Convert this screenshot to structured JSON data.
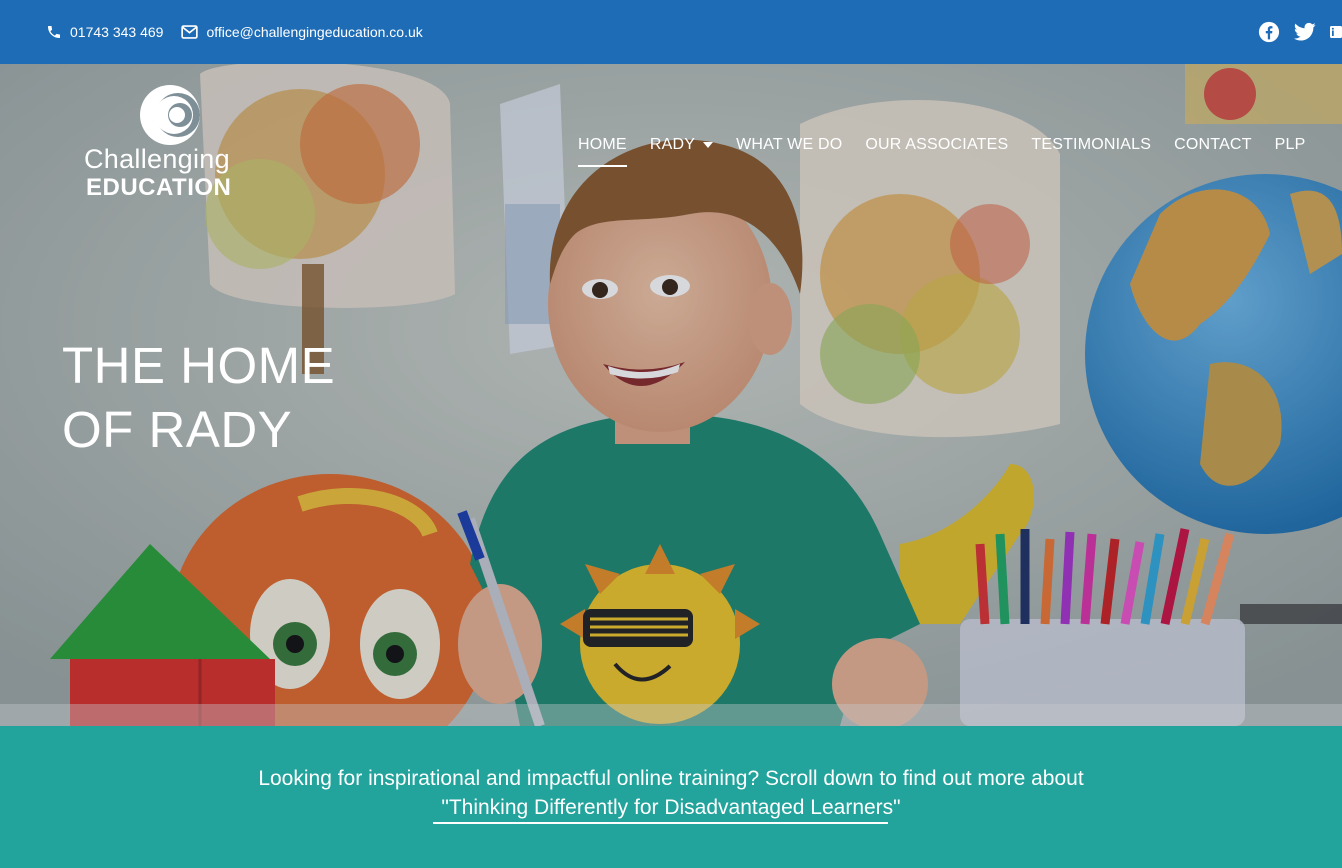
{
  "topbar": {
    "phone": "01743 343 469",
    "email": "office@challengingeducation.co.uk",
    "social": [
      "facebook-icon",
      "twitter-icon",
      "linkedin-icon"
    ],
    "background": "#1e6cb6"
  },
  "logo": {
    "line1": "Challenging",
    "line2": "EDUCATION"
  },
  "nav": {
    "items": [
      {
        "label": "HOME",
        "active": true
      },
      {
        "label": "RADY",
        "dropdown": true
      },
      {
        "label": "WHAT WE DO"
      },
      {
        "label": "OUR ASSOCIATES"
      },
      {
        "label": "TESTIMONIALS"
      },
      {
        "label": "CONTACT"
      },
      {
        "label": "PLP"
      }
    ]
  },
  "hero": {
    "headline_line1": "THE HOME",
    "headline_line2": "OF RADY"
  },
  "banner": {
    "line1": "Looking for inspirational and impactful online training? Scroll down to find out more about",
    "line2_link": "\"Thinking Differently for Disadvantaged",
    "line2_rest": " Learners\"",
    "background": "#22a39c"
  }
}
